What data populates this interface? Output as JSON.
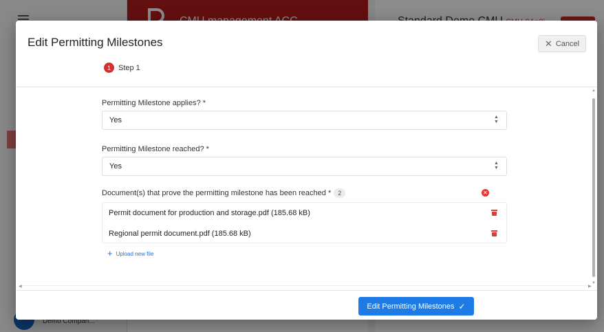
{
  "background": {
    "center_title": "CMU management ACC",
    "right_title": "Standard Demo CMU",
    "right_code": "CMU-9A=8i",
    "company": "Demo Compan..."
  },
  "modal": {
    "title": "Edit Permitting Milestones",
    "cancel_label": "Cancel",
    "step_number": "1",
    "step_label": "Step 1",
    "fields": [
      {
        "label": "Permitting Milestone applies? *",
        "value": "Yes"
      },
      {
        "label": "Permitting Milestone reached? *",
        "value": "Yes"
      }
    ],
    "documents": {
      "label": "Document(s) that prove the permitting milestone has been reached *",
      "count": "2",
      "files": [
        "Permit document for production and storage.pdf (185.68 kB)",
        "Regional permit document.pdf (185.68 kB)"
      ],
      "upload_label": "Upload new file"
    },
    "submit_label": "Edit Permitting Milestones"
  },
  "colors": {
    "accent": "#1e7be6",
    "danger": "#e53935",
    "brand": "#b71c1c"
  },
  "icons": {
    "cancel": "close-icon",
    "clear_all": "clear-circle-icon",
    "delete": "trash-icon",
    "upload": "plus-icon",
    "submit": "check-icon",
    "select": "select-arrows-icon"
  }
}
